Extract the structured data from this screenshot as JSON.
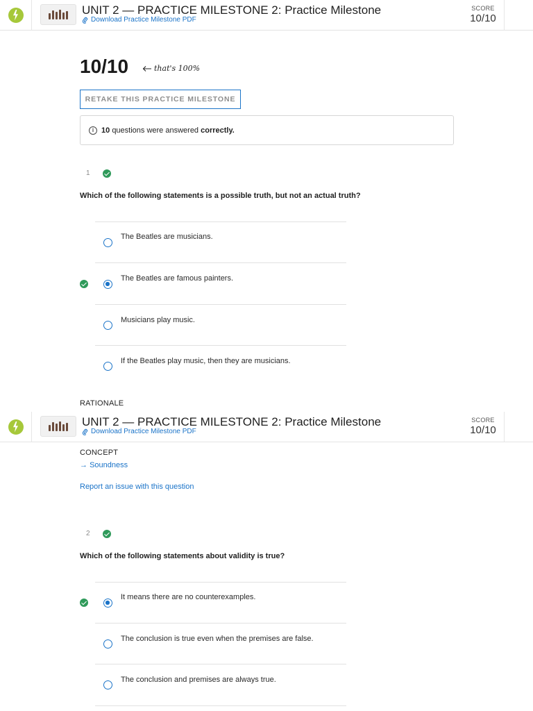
{
  "header": {
    "unit_title": "UNIT 2 — PRACTICE MILESTONE 2: Practice Milestone",
    "pdf_link": "Download Practice Milestone PDF",
    "score_label": "SCORE",
    "score_value": "10/10"
  },
  "summary": {
    "score": "10/10",
    "note": "that's 100%",
    "retake_label": "RETAKE THIS PRACTICE MILESTONE",
    "info_count": "10",
    "info_mid": "questions were answered",
    "info_result": "correctly."
  },
  "questions": [
    {
      "number": "1",
      "text": "Which of the following statements is a possible truth, but not an actual truth?",
      "options": [
        "The Beatles are musicians.",
        "The Beatles are famous painters.",
        "Musicians play music.",
        "If the Beatles play music, then they are musicians."
      ],
      "selected_index": 1,
      "rationale_label": "RATIONALE",
      "concept_label": "CONCEPT",
      "concept_link": "Soundness",
      "report_link": "Report an issue with this question"
    },
    {
      "number": "2",
      "text": "Which of the following statements about validity is true?",
      "options": [
        "It means there are no counterexamples.",
        "The conclusion is true even when the premises are false.",
        "The conclusion and premises are always true."
      ],
      "selected_index": 0
    }
  ],
  "colors": {
    "accent": "#1a73c8",
    "success": "#2f9a5a",
    "logo": "#a6c83a"
  }
}
